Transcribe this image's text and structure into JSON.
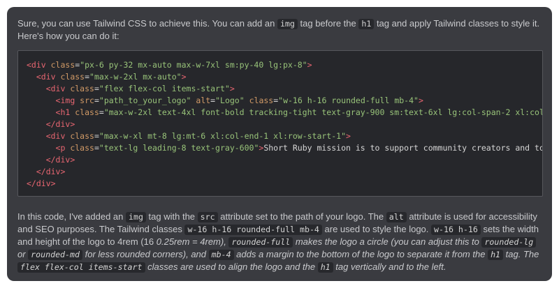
{
  "intro": {
    "t1": "Sure, you can use Tailwind CSS to achieve this. You can add an ",
    "c1": "img",
    "t2": " tag before the ",
    "c2": "h1",
    "t3": " tag and apply Tailwind classes to style it. Here's how you can do it:"
  },
  "code": {
    "l1": {
      "i": "",
      "a": "<div ",
      "b": "class",
      "c": "=",
      "d": "\"px-6 py-32 mx-auto max-w-7xl sm:py-40 lg:px-8\"",
      "e": ">"
    },
    "l2": {
      "i": "  ",
      "a": "<div ",
      "b": "class",
      "c": "=",
      "d": "\"max-w-2xl mx-auto\"",
      "e": ">"
    },
    "l3": {
      "i": "    ",
      "a": "<div ",
      "b": "class",
      "c": "=",
      "d": "\"flex flex-col items-start\"",
      "e": ">"
    },
    "l4": {
      "i": "      ",
      "a": "<img ",
      "b": "src",
      "c": "=",
      "d": "\"path_to_your_logo\"",
      "e": " ",
      "f": "alt",
      "g": "=",
      "h": "\"Logo\"",
      "j": " ",
      "k": "class",
      "l": "=",
      "m": "\"w-16 h-16 rounded-full mb-4\"",
      "n": ">"
    },
    "l5": {
      "i": "      ",
      "a": "<h1 ",
      "b": "class",
      "c": "=",
      "d": "\"max-w-2xl text-4xl font-bold tracking-tight text-gray-900 sm:text-6xl lg:col-span-2 xl:col"
    },
    "l6": {
      "i": "    ",
      "a": "</div>"
    },
    "l7": {
      "i": "    ",
      "a": "<div ",
      "b": "class",
      "c": "=",
      "d": "\"max-w-xl mt-8 lg:mt-6 xl:col-end-1 xl:row-start-1\"",
      "e": ">"
    },
    "l8": {
      "i": "      ",
      "a": "<p ",
      "b": "class",
      "c": "=",
      "d": "\"text-lg leading-8 text-gray-600\"",
      "e": ">",
      "f": "Short Ruby mission is to support community creators and to"
    },
    "l9": {
      "i": "    ",
      "a": "</div>"
    },
    "l10": {
      "i": "  ",
      "a": "</div>"
    },
    "l11": {
      "i": "",
      "a": "</div>"
    }
  },
  "explanation": {
    "t1": "In this code, I've added an ",
    "c1": "img",
    "t2": " tag with the ",
    "c2": "src",
    "t3": " attribute set to the path of your logo. The ",
    "c3": "alt",
    "t4": " attribute is used for accessibility and SEO purposes. The Tailwind classes ",
    "c4": "w-16 h-16 rounded-full mb-4",
    "t5": " are used to style the logo. ",
    "c5": "w-16 h-16",
    "t6": " sets the width and height of the logo to 4rem (16 ",
    "t7": "0.25rem = 4rem), ",
    "c6": "rounded-full",
    "t8": " makes the logo a circle (you can adjust this to ",
    "c7": "rounded-lg",
    "t9": " or ",
    "c8": "rounded-md",
    "t10": " for less rounded corners), and ",
    "c9": "mb-4",
    "t11": " adds a margin to the bottom of the logo to separate it from the ",
    "c10": "h1",
    "t12": " tag. The ",
    "c11": "flex flex-col items-start",
    "t13": " classes are used to align the logo and the ",
    "c12": "h1",
    "t14": " tag vertically and to the left."
  }
}
